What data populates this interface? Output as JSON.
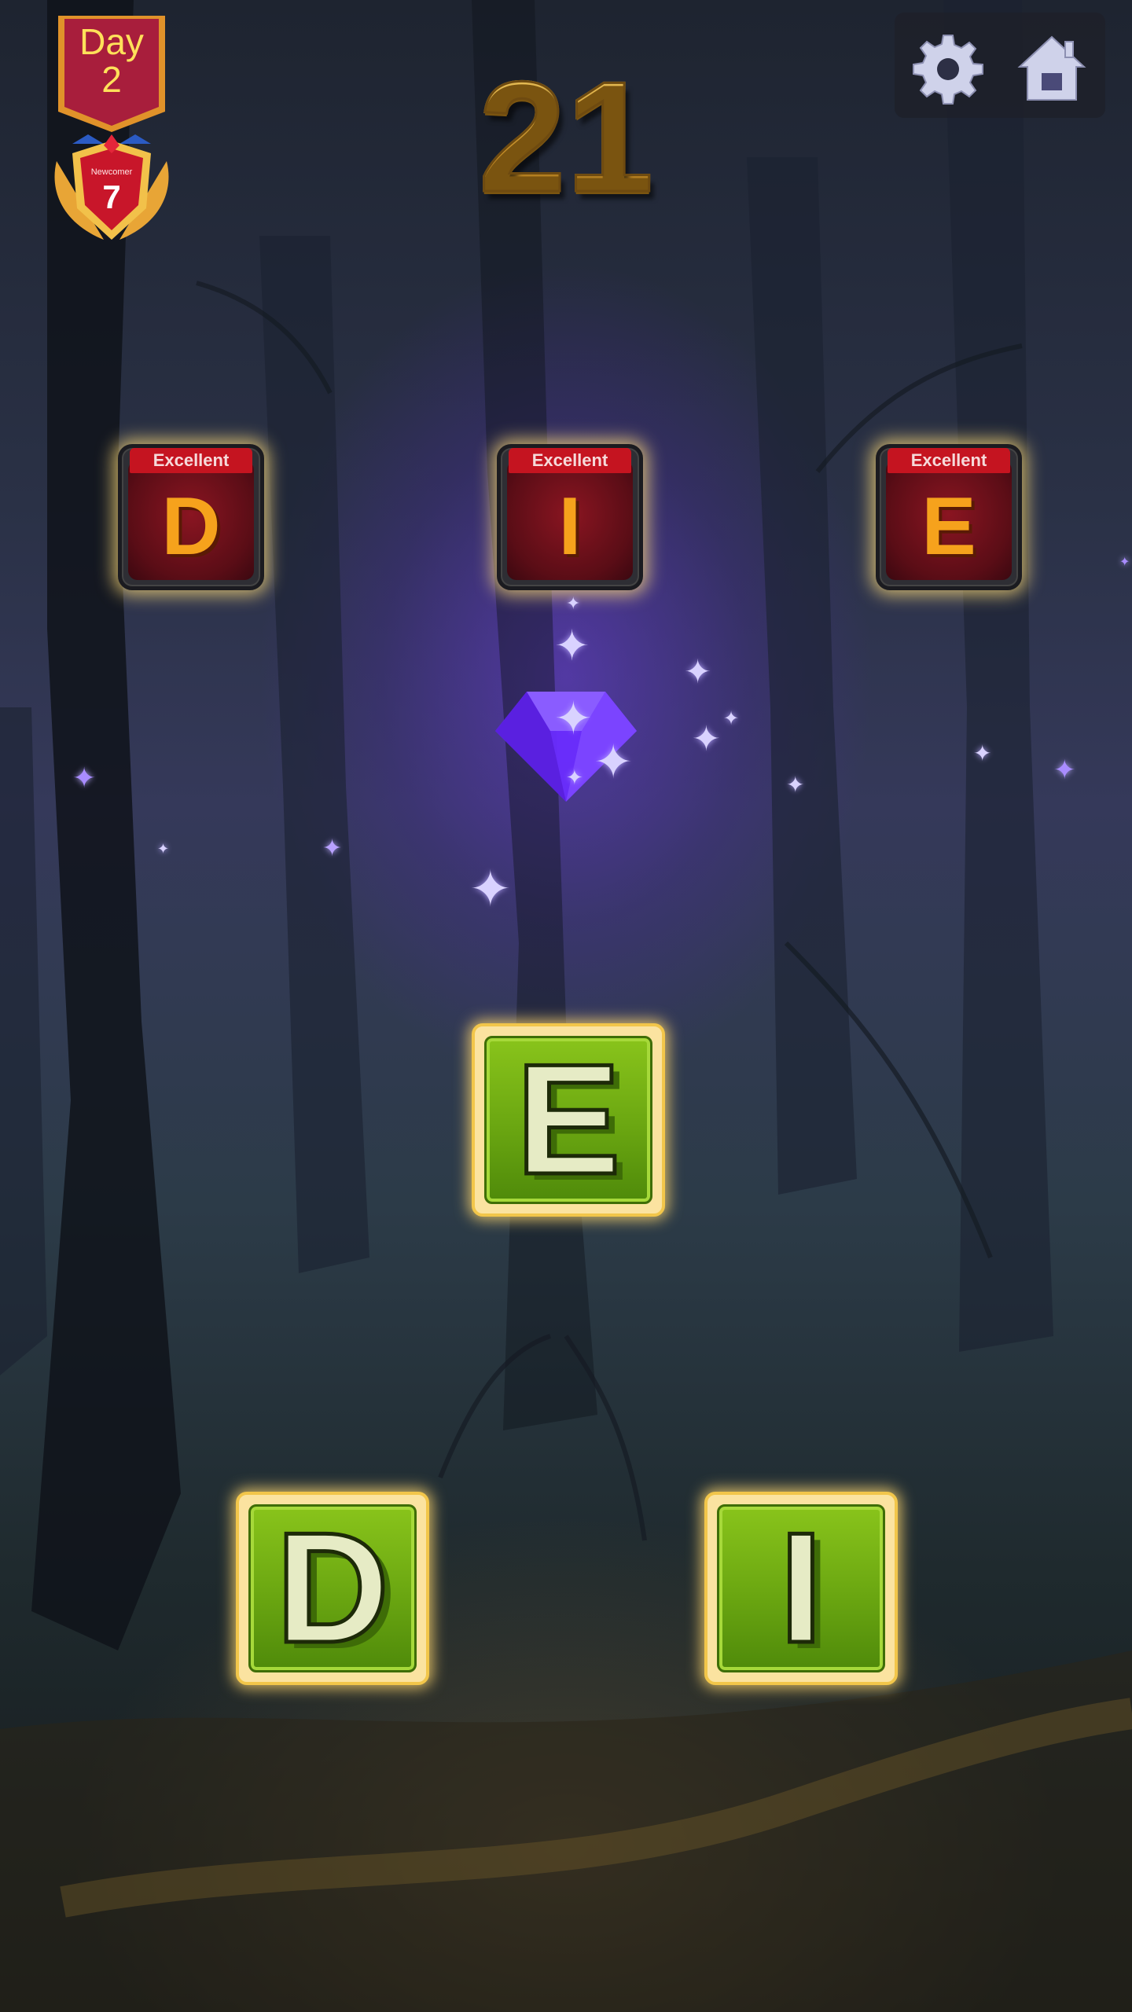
{
  "day_banner": {
    "label": "Day",
    "number": "2",
    "color": "#a81e3c"
  },
  "rank_badge": {
    "title": "Newcomer",
    "level": "7"
  },
  "score": "21",
  "toolbar": {
    "settings_icon": "gear-icon",
    "home_icon": "home-icon"
  },
  "target_word": [
    {
      "tag": "Excellent",
      "letter": "D"
    },
    {
      "tag": "Excellent",
      "letter": "I"
    },
    {
      "tag": "Excellent",
      "letter": "E"
    }
  ],
  "gem": {
    "icon": "purple-gem-icon",
    "color": "#6a2cff"
  },
  "letter_tiles": [
    {
      "letter": "E"
    },
    {
      "letter": "D"
    },
    {
      "letter": "I"
    }
  ],
  "colors": {
    "tile_green": "#6aa611",
    "tile_glow": "#f2c64a",
    "word_red": "#8a1521",
    "letter_orange": "#f6a21c"
  }
}
